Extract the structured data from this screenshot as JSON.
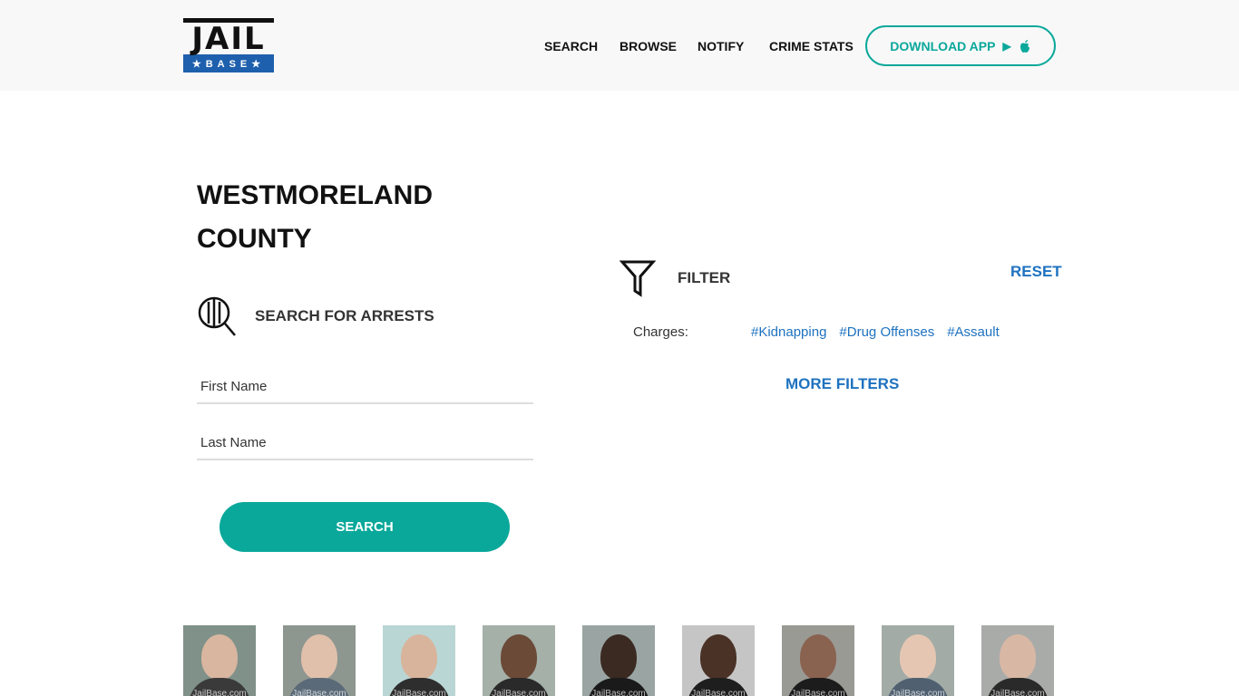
{
  "logo": {
    "top_text": "JAIL",
    "bottom_text": "★BASE★"
  },
  "nav": {
    "search": "SEARCH",
    "browse": "BROWSE",
    "notify": "NOTIFY",
    "crime_stats": "CRIME STATS"
  },
  "download": {
    "label": "DOWNLOAD APP",
    "icons": [
      "play-store-icon",
      "apple-icon"
    ]
  },
  "page": {
    "title_line1": "WESTMORELAND",
    "title_line2": "COUNTY"
  },
  "search": {
    "heading": "SEARCH FOR ARRESTS",
    "first_name_placeholder": "First Name",
    "last_name_placeholder": "Last Name",
    "button": "SEARCH"
  },
  "filter": {
    "heading": "FILTER",
    "reset": "RESET",
    "charges_label": "Charges:",
    "tags": [
      "#Kidnapping",
      "#Drug Offenses",
      "#Assault"
    ],
    "more": "MORE FILTERS"
  },
  "photos": {
    "watermark": "JailBase.com",
    "items": [
      {
        "bg": "#7f9188",
        "skin": "#d9b6a0",
        "shirt": "#3a3a3a"
      },
      {
        "bg": "#8e9690",
        "skin": "#e0c0aa",
        "shirt": "#5a6a78"
      },
      {
        "bg": "#b9d6d4",
        "skin": "#d8b49c",
        "shirt": "#2e2e2e"
      },
      {
        "bg": "#a4b0a8",
        "skin": "#6b4a38",
        "shirt": "#2a2a2a"
      },
      {
        "bg": "#9aa5a3",
        "skin": "#3b2a22",
        "shirt": "#1a1a1a"
      },
      {
        "bg": "#c5c5c5",
        "skin": "#4a3226",
        "shirt": "#1e1e1e"
      },
      {
        "bg": "#9a9a94",
        "skin": "#8a6250",
        "shirt": "#1c1c1c"
      },
      {
        "bg": "#a2aba6",
        "skin": "#e4c6b2",
        "shirt": "#506070"
      },
      {
        "bg": "#a9aba8",
        "skin": "#d8b8a4",
        "shirt": "#2a2a2a"
      }
    ]
  },
  "colors": {
    "accent": "#0aa89b",
    "link": "#1e72c0",
    "logo_blue": "#1e60ad"
  }
}
